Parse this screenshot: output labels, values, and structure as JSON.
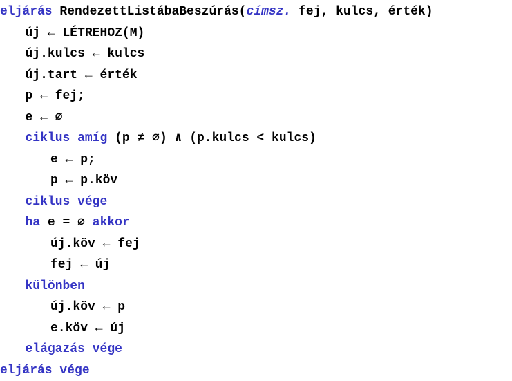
{
  "colors": {
    "keyword": "#3434c4",
    "text": "#000000",
    "background": "#ffffff"
  },
  "code": [
    {
      "indent": 0,
      "tokens": [
        {
          "t": "eljárás",
          "c": "kw"
        },
        {
          "t": " RendezettListábaBeszúrás("
        },
        {
          "t": "címsz.",
          "c": "kw",
          "i": true
        },
        {
          "t": " fej, kulcs, érték)"
        }
      ]
    },
    {
      "indent": 1,
      "tokens": [
        {
          "t": "új ← LÉTREHOZ(M)"
        }
      ]
    },
    {
      "indent": 1,
      "tokens": [
        {
          "t": "új.kulcs ← kulcs"
        }
      ]
    },
    {
      "indent": 1,
      "tokens": [
        {
          "t": "új.tart ← érték"
        }
      ]
    },
    {
      "indent": 1,
      "tokens": [
        {
          "t": "p ← fej;"
        }
      ]
    },
    {
      "indent": 1,
      "tokens": [
        {
          "t": "e ← ∅"
        }
      ]
    },
    {
      "indent": 1,
      "tokens": [
        {
          "t": "ciklus amíg",
          "c": "kw"
        },
        {
          "t": " (p ≠ ∅) ∧ (p.kulcs < kulcs)"
        }
      ]
    },
    {
      "indent": 2,
      "tokens": [
        {
          "t": "e ← p;"
        }
      ]
    },
    {
      "indent": 2,
      "tokens": [
        {
          "t": "p ← p.köv"
        }
      ]
    },
    {
      "indent": 1,
      "tokens": [
        {
          "t": "ciklus vége",
          "c": "kw"
        }
      ]
    },
    {
      "indent": 1,
      "tokens": [
        {
          "t": "ha",
          "c": "kw"
        },
        {
          "t": " e = ∅ "
        },
        {
          "t": "akkor",
          "c": "kw"
        }
      ]
    },
    {
      "indent": 2,
      "tokens": [
        {
          "t": "új.köv ← fej"
        }
      ]
    },
    {
      "indent": 2,
      "tokens": [
        {
          "t": "fej ← új"
        }
      ]
    },
    {
      "indent": 1,
      "tokens": [
        {
          "t": "különben",
          "c": "kw"
        }
      ]
    },
    {
      "indent": 2,
      "tokens": [
        {
          "t": "új.köv ← p"
        }
      ]
    },
    {
      "indent": 2,
      "tokens": [
        {
          "t": "e.köv ← új"
        }
      ]
    },
    {
      "indent": 1,
      "tokens": [
        {
          "t": "elágazás vége",
          "c": "kw"
        }
      ]
    },
    {
      "indent": 0,
      "tokens": [
        {
          "t": "eljárás vége",
          "c": "kw"
        }
      ]
    }
  ]
}
